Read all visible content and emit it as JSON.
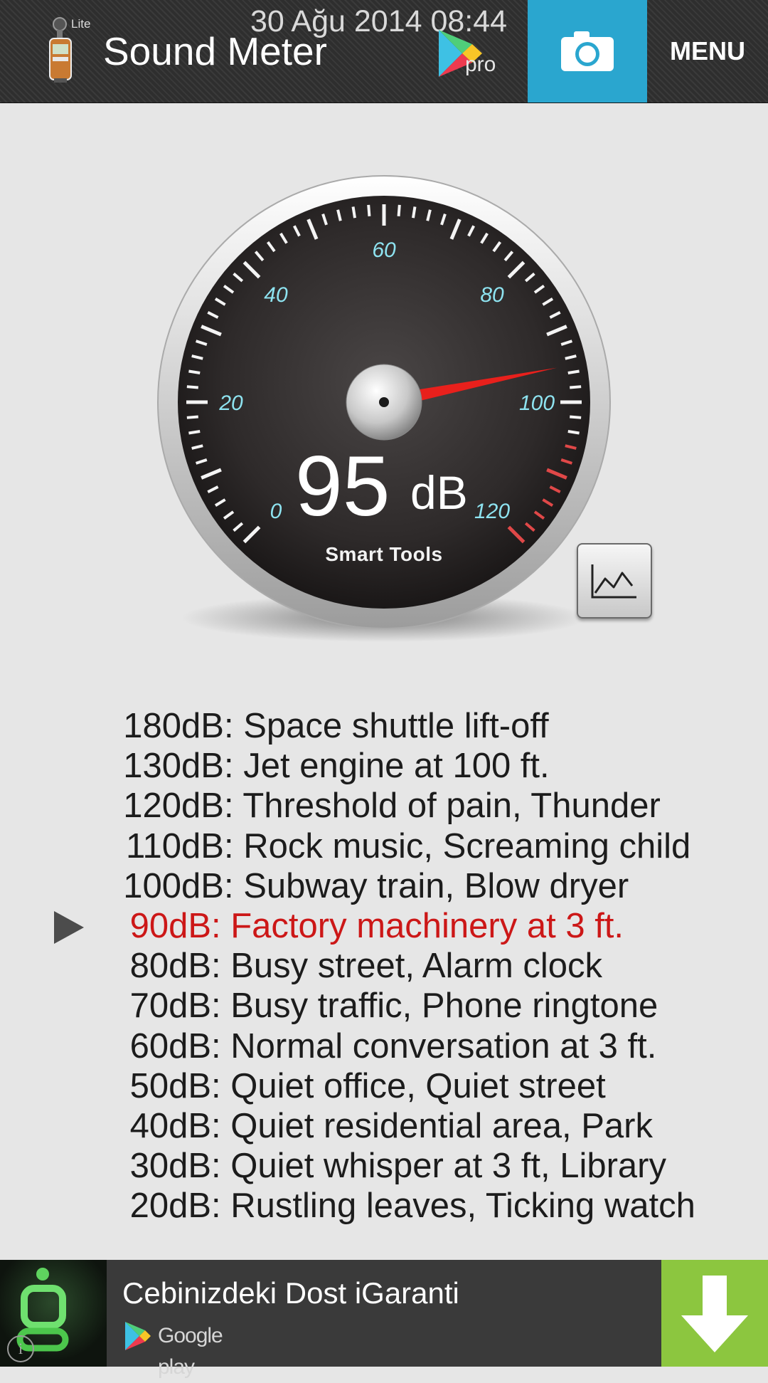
{
  "statusbar": {
    "time": "30 Ağu 2014 08:44"
  },
  "topbar": {
    "app_badge": "Lite",
    "title": "Sound Meter",
    "pro_label": "pro",
    "menu_label": "MENU"
  },
  "gauge": {
    "tick_labels": [
      "0",
      "20",
      "40",
      "60",
      "80",
      "100",
      "120"
    ],
    "value": "95",
    "unit": "dB",
    "brand": "Smart Tools",
    "needle_db": 95,
    "scale_min": 0,
    "scale_max": 120,
    "colors": {
      "label": "#8ee3f0",
      "needle": "#e8201c",
      "danger_ticks": "#e04848"
    }
  },
  "reference": {
    "current_index": 5,
    "rows": [
      {
        "level": "180dB",
        "desc": ": Space shuttle lift-off"
      },
      {
        "level": "130dB",
        "desc": ": Jet engine at 100 ft."
      },
      {
        "level": "120dB",
        "desc": ": Threshold of pain, Thunder"
      },
      {
        "level": "110dB",
        "desc": ": Rock music, Screaming child"
      },
      {
        "level": "100dB",
        "desc": ": Subway train, Blow dryer"
      },
      {
        "level": "90dB",
        "desc": ": Factory machinery at 3 ft."
      },
      {
        "level": "80dB",
        "desc": ": Busy street, Alarm clock"
      },
      {
        "level": "70dB",
        "desc": ": Busy traffic, Phone ringtone"
      },
      {
        "level": "60dB",
        "desc": ": Normal conversation at 3 ft."
      },
      {
        "level": "50dB",
        "desc": ": Quiet office, Quiet street"
      },
      {
        "level": "40dB",
        "desc": ": Quiet residential area, Park"
      },
      {
        "level": "30dB",
        "desc": ": Quiet whisper at 3 ft, Library"
      },
      {
        "level": "20dB",
        "desc": ": Rustling leaves, Ticking watch"
      }
    ],
    "colors": {
      "current": "#cc1717",
      "normal": "#1c1c1c"
    }
  },
  "ad": {
    "title": "Cebinizdeki Dost iGaranti",
    "store_label": "Google play",
    "info_glyph": "i"
  },
  "icons": {
    "app": "sound-meter-app-icon",
    "play_store": "google-play-icon",
    "camera": "camera-icon",
    "graph": "line-graph-icon",
    "arrow": "play-arrow-icon",
    "download": "download-arrow-icon"
  },
  "accent_colors": {
    "camera_button": "#2aa6cf",
    "ad_download": "#8cc63f"
  }
}
